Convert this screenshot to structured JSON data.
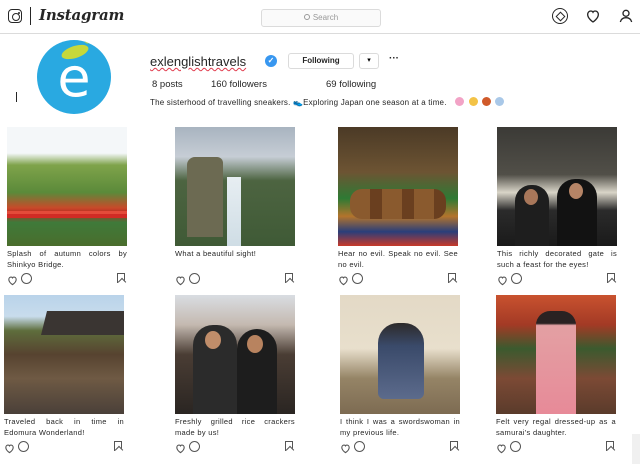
{
  "nav": {
    "wordmark": "Instagram",
    "search_placeholder": "Search"
  },
  "profile": {
    "username": "exlenglishtravels",
    "follow_label": "Following",
    "dropdown_glyph": "▾",
    "more_glyph": "···",
    "posts": "8 posts",
    "followers": "160 followers",
    "following": "69 following",
    "bio": "The sisterhood of travelling sneakers. 👟Exploring Japan one season at a time.",
    "bio_emoji_colors": [
      "#f2a3c6",
      "#f3c347",
      "#d05a2a",
      "#a9c8e8"
    ]
  },
  "posts": [
    {
      "caption": "Splash of autumn colors by Shinkyo Bridge."
    },
    {
      "caption": "What a beautiful sight!"
    },
    {
      "caption": "Hear no evil. Speak no evil. See no evil."
    },
    {
      "caption": "This richly decorated gate is such a feast for the eyes!"
    },
    {
      "caption": "Traveled back in time in Edomura Wonderland!"
    },
    {
      "caption": "Freshly grilled rice crackers made by us!"
    },
    {
      "caption": "I think I was a swordswoman in my previous life."
    },
    {
      "caption": "Felt very regal dressed-up as a samurai's daughter."
    }
  ],
  "colors": {
    "avatar_bg": "#29a9e1",
    "verified": "#3897f0"
  }
}
